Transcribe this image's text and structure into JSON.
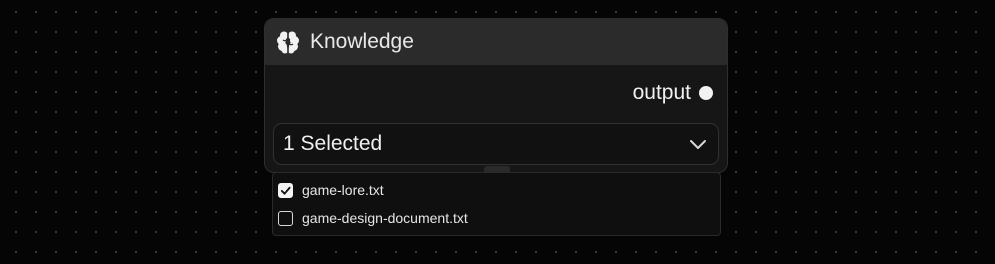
{
  "node": {
    "title": "Knowledge",
    "icon": "brain-icon",
    "output_label": "output"
  },
  "select": {
    "value": "1 Selected"
  },
  "dropdown": {
    "options": [
      {
        "label": "game-lore.txt",
        "checked": true
      },
      {
        "label": "game-design-document.txt",
        "checked": false
      }
    ]
  },
  "colors": {
    "canvas": "#050505",
    "node_body": "#161616",
    "node_header": "#2b2b2b",
    "text": "#f0f0f0"
  }
}
